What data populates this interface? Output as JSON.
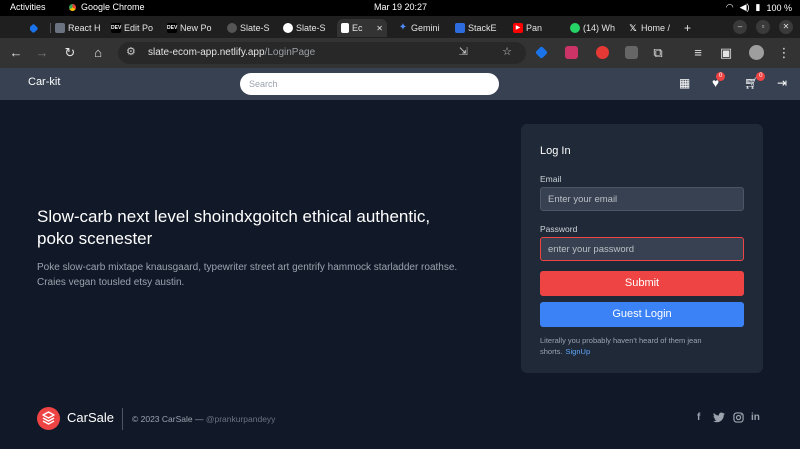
{
  "system_bar": {
    "activities": "Activities",
    "app_name": "Google Chrome",
    "clock": "Mar 19  20:27",
    "battery": "100 %"
  },
  "tabs": [
    {
      "label": "",
      "favicon": "gem-icon",
      "color": "#1a73e8"
    },
    {
      "label": "React H",
      "favicon": "react-grid-icon",
      "color": "#6b7280"
    },
    {
      "label": "Edit Po",
      "favicon": "dev-icon",
      "color": "#111111"
    },
    {
      "label": "New Po",
      "favicon": "dev-icon",
      "color": "#111111"
    },
    {
      "label": "Slate-S",
      "favicon": "globe-icon",
      "color": "#444444"
    },
    {
      "label": "Slate-S",
      "favicon": "github-icon",
      "color": "#ffffff"
    },
    {
      "label": "Ec",
      "favicon": "page-icon",
      "color": "#ffffff"
    },
    {
      "label": "Gemini",
      "favicon": "gemini-icon",
      "color": "#4f8bf9"
    },
    {
      "label": "StackE",
      "favicon": "stackedit-icon",
      "color": "#2d6cdf"
    },
    {
      "label": "Pan",
      "favicon": "youtube-icon",
      "color": "#ff0000"
    },
    {
      "label": "(14) Wh",
      "favicon": "whatsapp-icon",
      "color": "#25d366"
    },
    {
      "label": "Home /",
      "favicon": "x-icon",
      "color": "#000000"
    }
  ],
  "browser": {
    "url_host": "slate-ecom-app.netlify.app",
    "url_path": "/LoginPage"
  },
  "header": {
    "brand": "Car-kit",
    "search_placeholder": "Search",
    "wishlist_count": "0",
    "cart_count": "0"
  },
  "hero": {
    "title": "Slow-carb next level shoindxgoitch ethical authentic, poko scenester",
    "description": "Poke slow-carb mixtape knausgaard, typewriter street art gentrify hammock starladder roathse. Craies vegan tousled etsy austin."
  },
  "login": {
    "title": "Log In",
    "email_label": "Email",
    "email_placeholder": "Enter your email",
    "password_label": "Password",
    "password_placeholder": "enter your password",
    "submit_label": "Submit",
    "guest_label": "Guest Login",
    "note": "Literally you probably haven't heard of them jean shorts.",
    "signup_link": "SignUp"
  },
  "footer": {
    "brand": "CarSale",
    "copyright": "© 2023 CarSale —",
    "handle": "@prankurpandeyy",
    "social": [
      "facebook-icon",
      "twitter-icon",
      "instagram-icon",
      "linkedin-icon"
    ]
  },
  "colors": {
    "page_bg": "#111827",
    "header_bg": "#374151",
    "card_bg": "#1f2937",
    "accent_red": "#ef4444",
    "accent_blue": "#3b82f6"
  }
}
